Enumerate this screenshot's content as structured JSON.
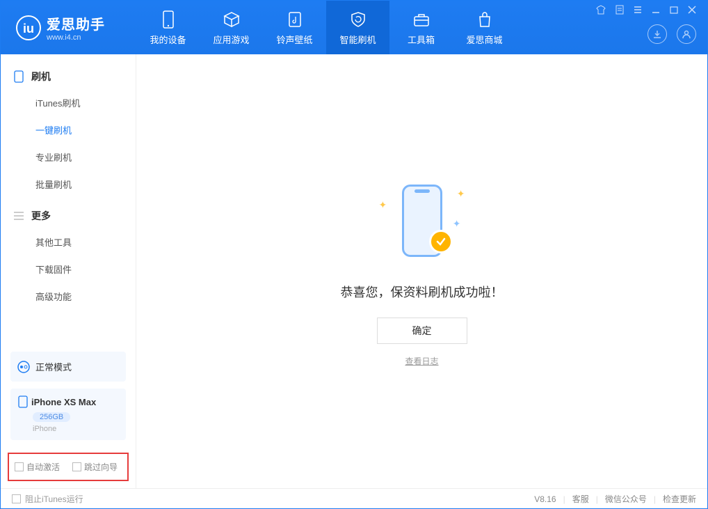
{
  "app": {
    "title": "爱思助手",
    "subtitle": "www.i4.cn"
  },
  "tabs": [
    {
      "label": "我的设备"
    },
    {
      "label": "应用游戏"
    },
    {
      "label": "铃声壁纸"
    },
    {
      "label": "智能刷机"
    },
    {
      "label": "工具箱"
    },
    {
      "label": "爱思商城"
    }
  ],
  "sidebar": {
    "shuaji": {
      "header": "刷机",
      "items": [
        "iTunes刷机",
        "一键刷机",
        "专业刷机",
        "批量刷机"
      ]
    },
    "more": {
      "header": "更多",
      "items": [
        "其他工具",
        "下载固件",
        "高级功能"
      ]
    }
  },
  "status": {
    "text": "正常模式"
  },
  "device": {
    "name": "iPhone XS Max",
    "storage": "256GB",
    "type": "iPhone"
  },
  "options": {
    "auto_activate": "自动激活",
    "skip_guide": "跳过向导"
  },
  "main": {
    "message": "恭喜您，保资料刷机成功啦！",
    "ok": "确定",
    "log": "查看日志"
  },
  "footer": {
    "block_itunes": "阻止iTunes运行",
    "version": "V8.16",
    "service": "客服",
    "wechat": "微信公众号",
    "update": "检查更新"
  }
}
